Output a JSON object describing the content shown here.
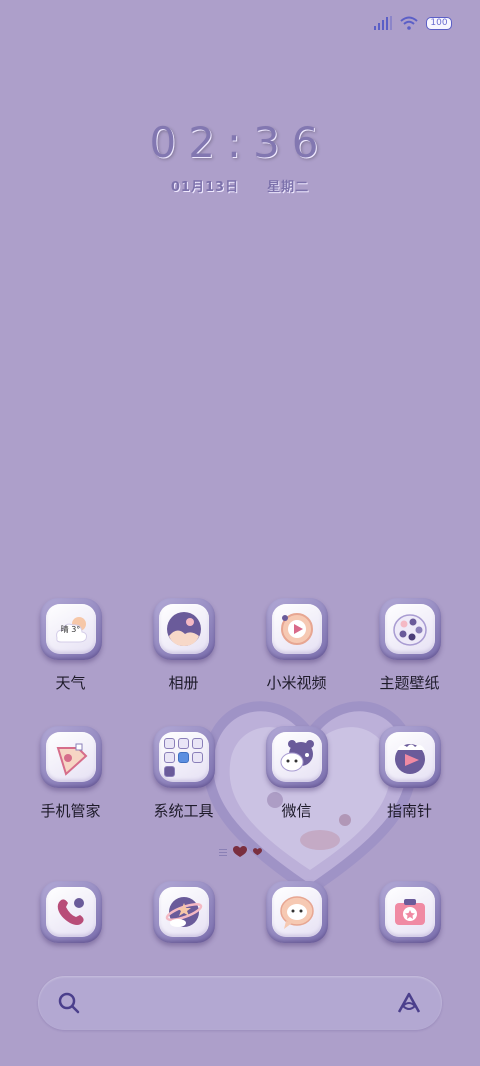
{
  "status_bar": {
    "battery": "100",
    "colors": {
      "accent": "#5b5fc7"
    }
  },
  "lockclock": {
    "time": "02:36",
    "date": "01月13日",
    "weekday": "星期二"
  },
  "apps_row1": [
    {
      "label": "天气",
      "icon": "weather-icon",
      "badge": "晴 3°"
    },
    {
      "label": "相册",
      "icon": "gallery-icon"
    },
    {
      "label": "小米视频",
      "icon": "video-icon"
    },
    {
      "label": "主题壁纸",
      "icon": "theme-icon"
    }
  ],
  "apps_row2": [
    {
      "label": "手机管家",
      "icon": "security-icon"
    },
    {
      "label": "系统工具",
      "icon": "folder-icon"
    },
    {
      "label": "微信",
      "icon": "wechat-icon"
    },
    {
      "label": "指南针",
      "icon": "compass-icon"
    }
  ],
  "dock": [
    {
      "icon": "phone-icon"
    },
    {
      "icon": "browser-icon"
    },
    {
      "icon": "messages-icon"
    },
    {
      "icon": "camera-icon"
    }
  ],
  "colors": {
    "background": "#ad9fca",
    "icon_frame": "#8a7fb9",
    "accent_pink": "#f4b9c4",
    "accent_purple": "#6a5b9a"
  }
}
